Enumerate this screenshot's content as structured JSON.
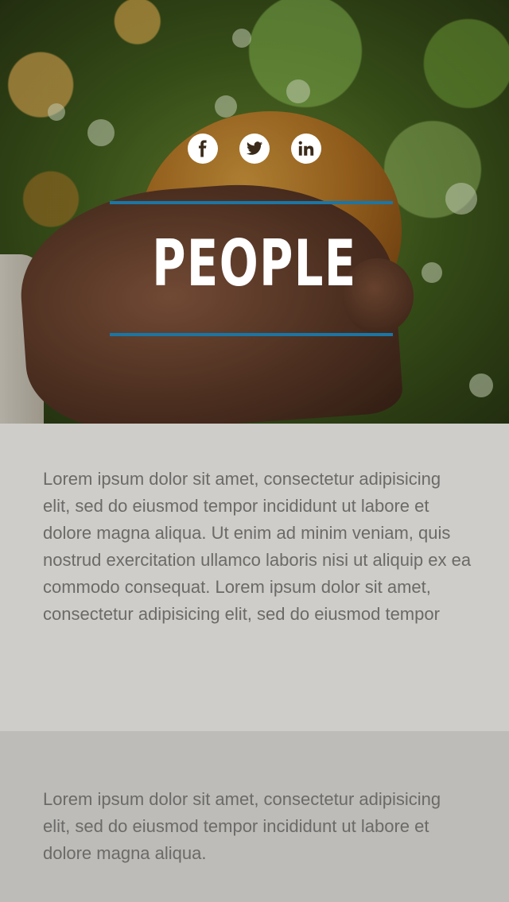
{
  "hero": {
    "title": "PEOPLE",
    "accent_color": "#1a76a6",
    "social": [
      {
        "name": "facebook-icon",
        "glyph": "f"
      },
      {
        "name": "twitter-icon",
        "glyph": "twitter bird"
      },
      {
        "name": "linkedin-icon",
        "glyph": "in"
      }
    ],
    "image": "hand holding an orange in an orchard"
  },
  "sections": [
    {
      "text": "Lorem ipsum dolor sit amet, consectetur adipisicing elit, sed do eiusmod tempor incididunt ut labore et dolore magna aliqua. Ut enim ad minim veniam, quis nostrud exercitation ullamco laboris nisi ut aliquip ex ea commodo consequat. Lorem ipsum dolor sit amet, consectetur adipisicing elit, sed do eiusmod tempor",
      "background": "#cfcdc9"
    },
    {
      "text": "Lorem ipsum dolor sit amet, consectetur adipisicing elit, sed do eiusmod tempor incididunt ut labore et dolore magna aliqua.",
      "background": "#bdbcb8"
    }
  ]
}
